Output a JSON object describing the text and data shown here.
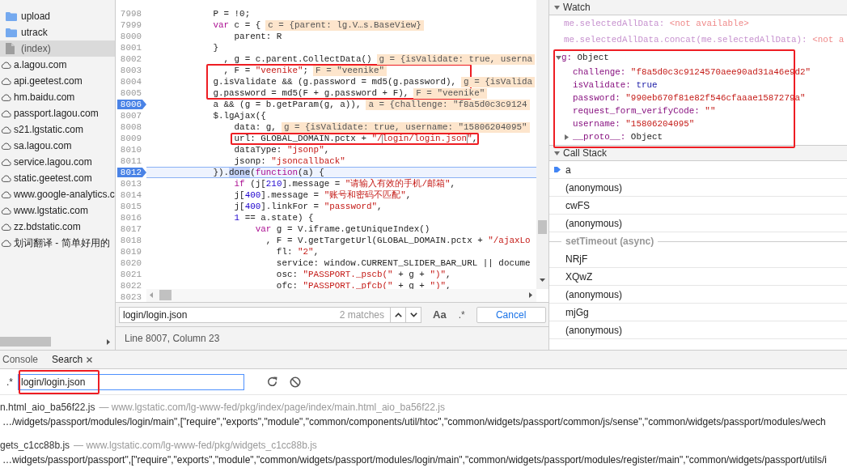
{
  "sidebar": {
    "items": [
      {
        "children": [
          {
            "label": "upload",
            "kind": "folder",
            "selected": false
          },
          {
            "label": "utrack",
            "kind": "folder",
            "selected": false
          },
          {
            "label": "(index)",
            "kind": "file",
            "selected": true
          }
        ]
      },
      {
        "label": "a.lagou.com",
        "kind": "domain",
        "selected": false
      },
      {
        "label": "api.geetest.com",
        "kind": "domain",
        "selected": false
      },
      {
        "label": "hm.baidu.com",
        "kind": "domain",
        "selected": false
      },
      {
        "label": "passport.lagou.com",
        "kind": "domain",
        "selected": false
      },
      {
        "label": "s21.lgstatic.com",
        "kind": "domain",
        "selected": false
      },
      {
        "label": "sa.lagou.com",
        "kind": "domain",
        "selected": false
      },
      {
        "label": "service.lagou.com",
        "kind": "domain",
        "selected": false
      },
      {
        "label": "static.geetest.com",
        "kind": "domain",
        "selected": false
      },
      {
        "label": "www.google-analytics.c",
        "kind": "domain",
        "selected": false
      },
      {
        "label": "www.lgstatic.com",
        "kind": "domain",
        "selected": false
      },
      {
        "label": "zz.bdstatic.com",
        "kind": "domain",
        "selected": false
      },
      {
        "label": "划词翻译 - 简单好用的",
        "kind": "domain",
        "selected": false
      }
    ]
  },
  "editor": {
    "lines": [
      {
        "number": "7998",
        "breakpoint": false,
        "paused": false,
        "tokens": [
          {
            "text": "            P = !0;",
            "kind": "plain"
          }
        ]
      },
      {
        "number": "7999",
        "breakpoint": false,
        "paused": false,
        "tokens": [
          {
            "text": "            var",
            "kind": "keyword"
          },
          {
            "text": " c = {",
            "kind": "plain"
          }
        ],
        "inline_value": "c = {parent: lg.V…s.BaseView}"
      },
      {
        "number": "8000",
        "breakpoint": false,
        "paused": false,
        "tokens": [
          {
            "text": "                parent: R",
            "kind": "plain"
          }
        ]
      },
      {
        "number": "8001",
        "breakpoint": false,
        "paused": false,
        "tokens": [
          {
            "text": "            }",
            "kind": "plain"
          }
        ]
      },
      {
        "number": "8002",
        "breakpoint": false,
        "paused": false,
        "tokens": [
          {
            "text": "              , g = c.parent.CollectData()",
            "kind": "plain"
          }
        ],
        "inline_value": "g = {isValidate: true, userna"
      },
      {
        "number": "8003",
        "breakpoint": false,
        "paused": false,
        "tokens": [
          {
            "text": "              , F = ",
            "kind": "plain"
          },
          {
            "text": "\"veenike\"",
            "kind": "string"
          },
          {
            "text": ";",
            "kind": "plain"
          }
        ],
        "inline_value": "F = \"veenike\""
      },
      {
        "number": "8004",
        "breakpoint": false,
        "paused": false,
        "tokens": [
          {
            "text": "            g.isValidate && (g.password = md5(g.password),",
            "kind": "plain"
          }
        ],
        "inline_value": "g = {isValida"
      },
      {
        "number": "8005",
        "breakpoint": false,
        "paused": false,
        "tokens": [
          {
            "text": "            g.password = md5(F + g.password + F),",
            "kind": "plain"
          }
        ],
        "inline_value": "F = \"veenike\""
      },
      {
        "number": "8006",
        "breakpoint": true,
        "paused": false,
        "tokens": [
          {
            "text": "            a && (g = b.getParam(g, a)),",
            "kind": "plain"
          }
        ],
        "inline_value": "a = {challenge: \"f8a5d0c3c9124"
      },
      {
        "number": "8007",
        "breakpoint": false,
        "paused": false,
        "tokens": [
          {
            "text": "            $.lgAjax({",
            "kind": "plain"
          }
        ]
      },
      {
        "number": "8008",
        "breakpoint": false,
        "paused": false,
        "tokens": [
          {
            "text": "                data: g,",
            "kind": "plain"
          }
        ],
        "inline_value": "g = {isValidate: true, username: \"15806204095\""
      },
      {
        "number": "8009",
        "breakpoint": false,
        "paused": false,
        "tokens": [
          {
            "text": "                url: GLOBAL_DOMAIN.pctx + ",
            "kind": "plain"
          },
          {
            "text": "\"/",
            "kind": "string"
          },
          {
            "text": "login/login.json",
            "kind": "match"
          },
          {
            "text": "\"",
            "kind": "string"
          },
          {
            "text": ",",
            "kind": "plain"
          }
        ]
      },
      {
        "number": "8010",
        "breakpoint": false,
        "paused": false,
        "tokens": [
          {
            "text": "                dataType: ",
            "kind": "plain"
          },
          {
            "text": "\"jsonp\"",
            "kind": "string"
          },
          {
            "text": ",",
            "kind": "plain"
          }
        ]
      },
      {
        "number": "8011",
        "breakpoint": false,
        "paused": false,
        "tokens": [
          {
            "text": "                jsonp: ",
            "kind": "plain"
          },
          {
            "text": "\"jsoncallback\"",
            "kind": "string"
          }
        ]
      },
      {
        "number": "8012",
        "breakpoint": true,
        "paused": true,
        "tokens": [
          {
            "text": "            }).",
            "kind": "plain"
          },
          {
            "text": "done",
            "kind": "paused"
          },
          {
            "text": "(",
            "kind": "plain"
          },
          {
            "text": "function",
            "kind": "keyword"
          },
          {
            "text": "(a) {",
            "kind": "plain"
          }
        ]
      },
      {
        "number": "8013",
        "breakpoint": false,
        "paused": false,
        "tokens": [
          {
            "text": "                if",
            "kind": "keyword"
          },
          {
            "text": " (j[",
            "kind": "plain"
          },
          {
            "text": "210",
            "kind": "number"
          },
          {
            "text": "].message = ",
            "kind": "plain"
          },
          {
            "text": "\"请输入有效的手机/邮箱\"",
            "kind": "string"
          },
          {
            "text": ",",
            "kind": "plain"
          }
        ]
      },
      {
        "number": "8014",
        "breakpoint": false,
        "paused": false,
        "tokens": [
          {
            "text": "                j[",
            "kind": "plain"
          },
          {
            "text": "400",
            "kind": "number"
          },
          {
            "text": "].message = ",
            "kind": "plain"
          },
          {
            "text": "\"账号和密码不匹配\"",
            "kind": "string"
          },
          {
            "text": ",",
            "kind": "plain"
          }
        ]
      },
      {
        "number": "8015",
        "breakpoint": false,
        "paused": false,
        "tokens": [
          {
            "text": "                j[",
            "kind": "plain"
          },
          {
            "text": "400",
            "kind": "number"
          },
          {
            "text": "].linkFor = ",
            "kind": "plain"
          },
          {
            "text": "\"password\"",
            "kind": "string"
          },
          {
            "text": ",",
            "kind": "plain"
          }
        ]
      },
      {
        "number": "8016",
        "breakpoint": false,
        "paused": false,
        "tokens": [
          {
            "text": "                1",
            "kind": "number"
          },
          {
            "text": " == a.state) {",
            "kind": "plain"
          }
        ]
      },
      {
        "number": "8017",
        "breakpoint": false,
        "paused": false,
        "tokens": [
          {
            "text": "                    var",
            "kind": "keyword"
          },
          {
            "text": " g = V.iframe.getUniqueIndex()",
            "kind": "plain"
          }
        ]
      },
      {
        "number": "8018",
        "breakpoint": false,
        "paused": false,
        "tokens": [
          {
            "text": "                      , F = V.getTargetUrl(GLOBAL_DOMAIN.pctx + ",
            "kind": "plain"
          },
          {
            "text": "\"/ajaxLo",
            "kind": "string"
          }
        ]
      },
      {
        "number": "8019",
        "breakpoint": false,
        "paused": false,
        "tokens": [
          {
            "text": "                        fl: ",
            "kind": "plain"
          },
          {
            "text": "\"2\"",
            "kind": "string"
          },
          {
            "text": ",",
            "kind": "plain"
          }
        ]
      },
      {
        "number": "8020",
        "breakpoint": false,
        "paused": false,
        "tokens": [
          {
            "text": "                        service: window.CURRENT_SLIDER_BAR_URL || docume",
            "kind": "plain"
          }
        ]
      },
      {
        "number": "8021",
        "breakpoint": false,
        "paused": false,
        "tokens": [
          {
            "text": "                        osc: ",
            "kind": "plain"
          },
          {
            "text": "\"PASSPORT._pscb(\"",
            "kind": "string"
          },
          {
            "text": " + g + ",
            "kind": "plain"
          },
          {
            "text": "\")\"",
            "kind": "string"
          },
          {
            "text": ",",
            "kind": "plain"
          }
        ]
      },
      {
        "number": "8022",
        "breakpoint": false,
        "paused": false,
        "tokens": [
          {
            "text": "                        ofc: ",
            "kind": "plain"
          },
          {
            "text": "\"PASSPORT._pfcb(\"",
            "kind": "string"
          },
          {
            "text": " + g + ",
            "kind": "plain"
          },
          {
            "text": "\")\"",
            "kind": "string"
          },
          {
            "text": ",",
            "kind": "plain"
          }
        ]
      },
      {
        "number": "8023",
        "breakpoint": false,
        "paused": false
      }
    ]
  },
  "source_search": {
    "query": "login/login.json",
    "match_count": "2 matches",
    "case_toggle": "Aa",
    "regex_toggle": ".*",
    "cancel": "Cancel"
  },
  "status_bar": {
    "text": "Line 8007, Column 23"
  },
  "watch": {
    "title": "Watch",
    "expanded": true,
    "expressions": [
      {
        "name": "me.selectedAllData:",
        "value": "<not available>",
        "available": false
      },
      {
        "name": "me.selectedAllData.concat(me.selectedAllData):",
        "value": "<not a",
        "available": false
      },
      {
        "name": "g:",
        "value": "Object",
        "available": true,
        "expanded": true,
        "properties": [
          {
            "name": "challenge:",
            "value": "\"f8a5d0c3c9124570aee90ad31a46e9d2\"",
            "kind": "string"
          },
          {
            "name": "isValidate:",
            "value": "true",
            "kind": "boolean"
          },
          {
            "name": "password:",
            "value": "\"990eb670f81e82f546cfaaae1587279a\"",
            "kind": "string"
          },
          {
            "name": "request_form_verifyCode:",
            "value": "\"\"",
            "kind": "string"
          },
          {
            "name": "username:",
            "value": "\"15806204095\"",
            "kind": "string"
          },
          {
            "name": "__proto__:",
            "value": "Object",
            "kind": "object",
            "expanded": false
          }
        ]
      }
    ]
  },
  "call_stack": {
    "title": "Call Stack",
    "expanded": true,
    "frames": [
      {
        "kind": "frame",
        "name": "a",
        "selected": true
      },
      {
        "kind": "frame",
        "name": "(anonymous)",
        "selected": false
      },
      {
        "kind": "frame",
        "name": "cwFS",
        "selected": false
      },
      {
        "kind": "frame",
        "name": "(anonymous)",
        "selected": false
      },
      {
        "kind": "async",
        "name": "setTimeout (async)",
        "selected": false
      },
      {
        "kind": "frame",
        "name": "NRjF",
        "selected": false
      },
      {
        "kind": "frame",
        "name": "XQwZ",
        "selected": false
      },
      {
        "kind": "frame",
        "name": "(anonymous)",
        "selected": false
      },
      {
        "kind": "frame",
        "name": "mjGg",
        "selected": false
      },
      {
        "kind": "frame",
        "name": "(anonymous)",
        "selected": false
      }
    ]
  },
  "drawer": {
    "tabs": [
      {
        "label": "Console",
        "selected": false,
        "closable": false
      },
      {
        "label": "Search",
        "selected": true,
        "closable": true
      }
    ],
    "search": {
      "regex_toggle": ".*",
      "query": "login/login.json"
    },
    "results": [
      {
        "file": "n.html_aio_ba56f22.js",
        "path": "— www.lgstatic.com/lg-www-fed/pkg/index/page/index/main.html_aio_ba56f22.js",
        "matches": [
          "…/widgets/passport/modules/login/main\",[\"require\",\"exports\",\"module\",\"common/components/util/htoc\",\"common/widgets/passport/common/js/sense\",\"common/widgets/passport/modules/wech"
        ]
      },
      {
        "file": "gets_c1cc88b.js",
        "path": "— www.lgstatic.com/lg-www-fed/pkg/widgets_c1cc88b.js",
        "matches": [
          "…widgets/passport/passport\",[\"require\",\"exports\",\"module\",\"common/widgets/passport/modules/login/main\",\"common/widgets/passport/modules/register/main\",\"common/widgets/passport/utils/i"
        ]
      }
    ]
  }
}
